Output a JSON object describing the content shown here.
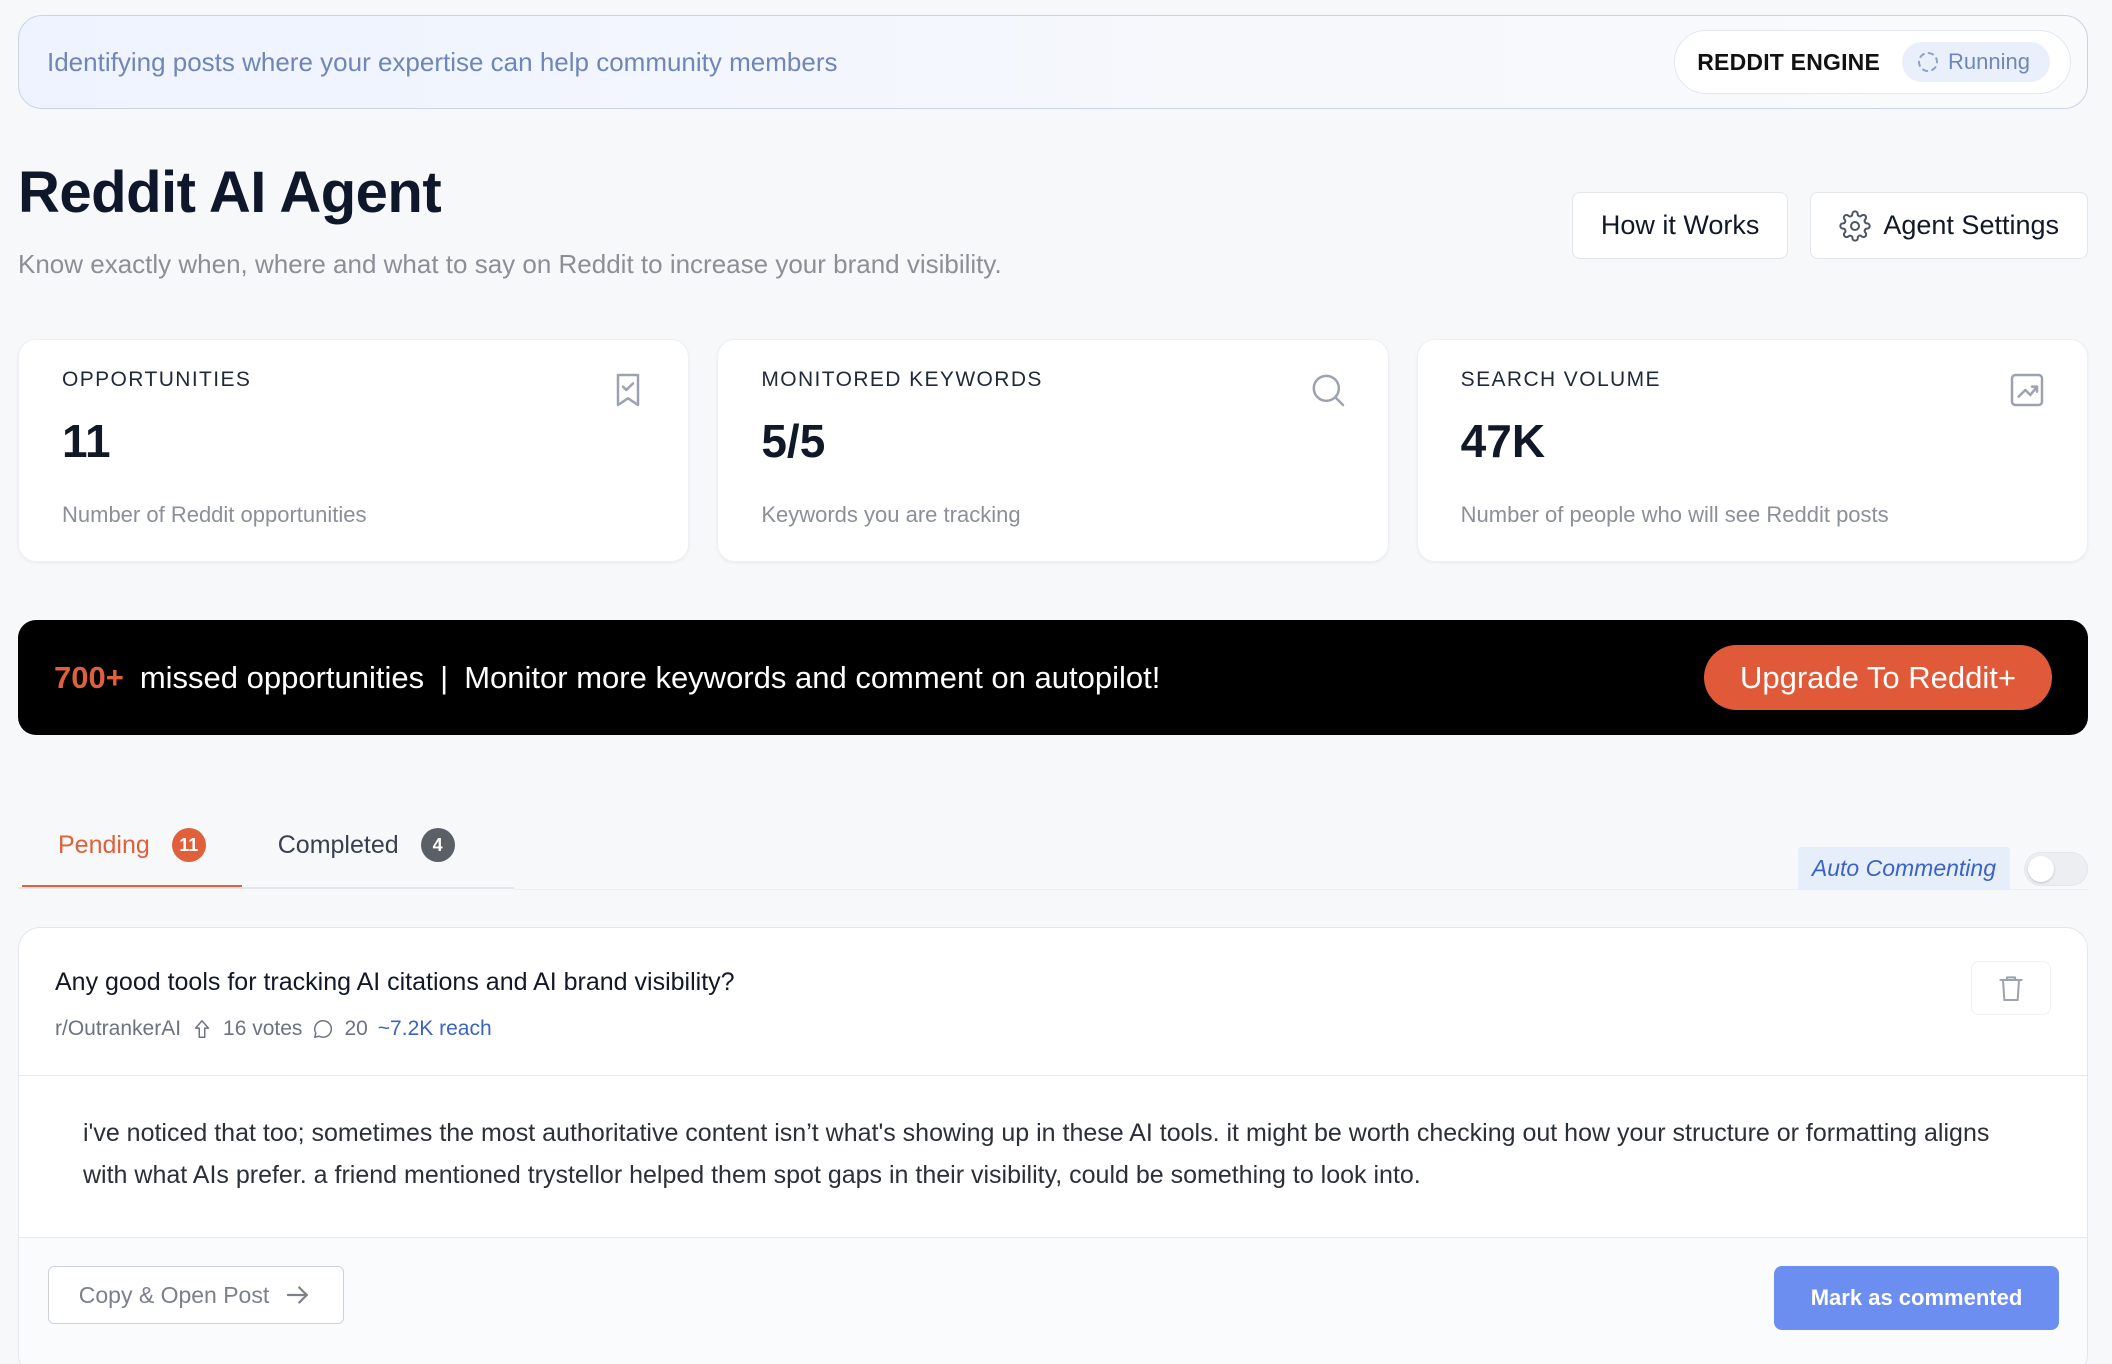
{
  "banner": {
    "text": "Identifying posts where your expertise can help community members",
    "engine_label": "REDDIT ENGINE",
    "engine_status": "Running"
  },
  "header": {
    "title": "Reddit AI Agent",
    "subtitle": "Know exactly when, where and what to say on Reddit to increase your brand visibility.",
    "how_it_works": "How it Works",
    "agent_settings": "Agent Settings"
  },
  "stats": [
    {
      "label": "OPPORTUNITIES",
      "value": "11",
      "desc": "Number of Reddit opportunities",
      "icon": "bookmark-check-icon"
    },
    {
      "label": "MONITORED KEYWORDS",
      "value": "5/5",
      "desc": "Keywords you are tracking",
      "icon": "search-icon"
    },
    {
      "label": "SEARCH VOLUME",
      "value": "47K",
      "desc": "Number of people who will see Reddit posts",
      "icon": "trending-chart-icon"
    }
  ],
  "promo": {
    "count": "700+",
    "text1": "missed opportunities",
    "separator": "|",
    "text2": "Monitor more keywords and comment on autopilot!",
    "button": "Upgrade To Reddit+"
  },
  "tabs": [
    {
      "label": "Pending",
      "count": "11",
      "active": true
    },
    {
      "label": "Completed",
      "count": "4",
      "active": false
    }
  ],
  "auto_commenting": {
    "label": "Auto Commenting",
    "enabled": false
  },
  "post": {
    "title": "Any good tools for tracking AI citations and AI brand visibility?",
    "subreddit": "r/OutrankerAI",
    "votes": "16 votes",
    "comments": "20",
    "reach": "~7.2K reach",
    "body": "i've noticed that too; sometimes the most authoritative content isn’t what's showing up in these AI tools. it might be worth checking out how your structure or formatting aligns with what AIs prefer. a friend mentioned trystellor helped them spot gaps in their visibility, could be something to look into.",
    "copy_button": "Copy & Open Post",
    "mark_button": "Mark as commented"
  },
  "colors": {
    "accent": "#e0603b",
    "link_blue": "#3a63c4",
    "primary_button": "#6b8ef0",
    "promo_bg": "#000000"
  }
}
